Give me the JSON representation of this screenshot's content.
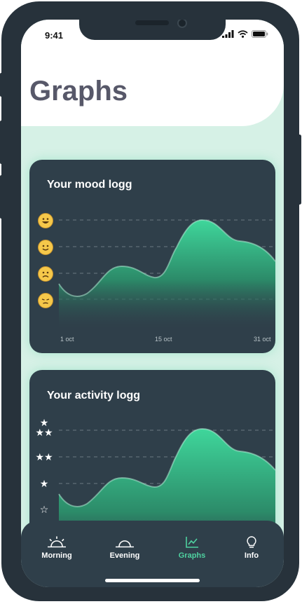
{
  "status_bar": {
    "time": "9:41"
  },
  "page": {
    "title": "Graphs"
  },
  "mood_card": {
    "title": "Your mood logg",
    "levels": [
      "very-happy-face-icon",
      "smiling-face-icon",
      "frowning-face-icon",
      "sad-face-icon"
    ],
    "x_labels": [
      "1 oct",
      "15 oct",
      "31 oct"
    ]
  },
  "activity_card": {
    "title": "Your activity logg",
    "levels": [
      "★\n★★",
      "★★",
      "★",
      "☆"
    ]
  },
  "nav": {
    "items": [
      {
        "label": "Morning",
        "icon": "sunrise-icon"
      },
      {
        "label": "Evening",
        "icon": "sunset-icon"
      },
      {
        "label": "Graphs",
        "icon": "chart-icon",
        "active": true
      },
      {
        "label": "Info",
        "icon": "lightbulb-icon"
      }
    ]
  },
  "colors": {
    "accent": "#4fd1a0",
    "card": "#2f3f4a",
    "frame": "#27323b",
    "background": "#d6f1e6",
    "title": "#575869"
  }
}
